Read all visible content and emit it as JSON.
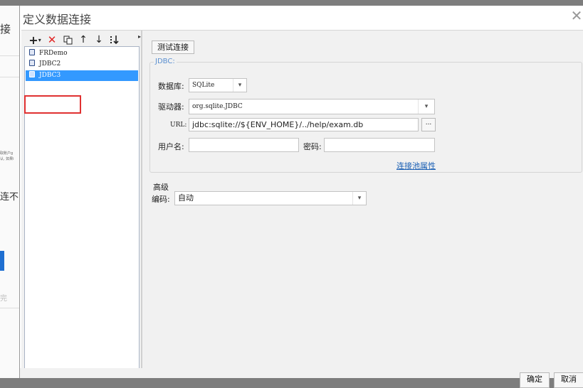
{
  "background": {
    "texts": [
      "接",
      "连不",
      "完"
    ],
    "small_texts": [
      "取账户g",
      "认, 如果i"
    ]
  },
  "dialog": {
    "title": "定义数据连接",
    "close_icon": "close-icon"
  },
  "toolbar": {
    "add": "+",
    "add_dropdown": "▾",
    "delete": "✕",
    "copy_icon": "copy-icon",
    "up": "↑",
    "down": "↓",
    "sort_icon": "sort-icon"
  },
  "connections": {
    "items": [
      {
        "label": "FRDemo"
      },
      {
        "label": "JDBC2"
      },
      {
        "label": "JDBC3",
        "selected": true
      }
    ]
  },
  "form": {
    "test_connection": "测试连接",
    "group_label": "JDBC:",
    "database_label": "数据库:",
    "database_value": "SQLite",
    "driver_label": "驱动器:",
    "driver_value": "org.sqlite.JDBC",
    "url_label": "URL:",
    "url_value": "jdbc:sqlite://${ENV_HOME}/../help/exam.db",
    "url_browse": "...",
    "username_label": "用户名:",
    "username_value": "",
    "password_label": "密码:",
    "password_value": "",
    "pool_link": "连接池属性"
  },
  "advanced": {
    "title": "高级",
    "encoding_label": "编码:",
    "encoding_value": "自动"
  },
  "footer": {
    "ok": "确定",
    "cancel": "取消"
  },
  "colors": {
    "selection": "#3399ff",
    "highlight_box": "#e03131",
    "link": "#1a5fb4",
    "delete": "#e02424"
  }
}
